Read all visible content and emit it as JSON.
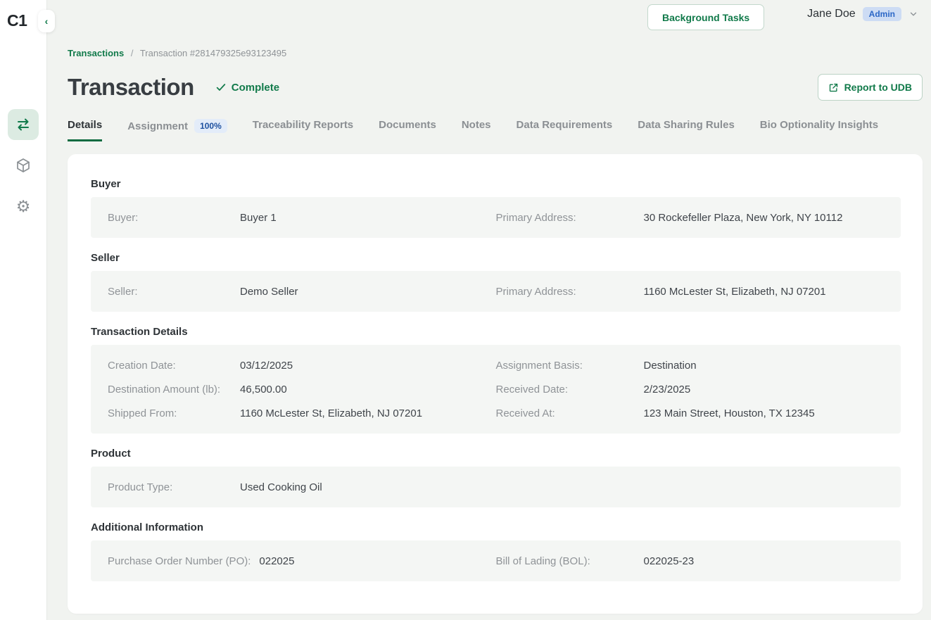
{
  "app": {
    "logo": "C1",
    "collapse_glyph": "‹"
  },
  "sidebar": {
    "items": [
      {
        "name": "transactions",
        "icon": "transfer-arrows-icon",
        "active": true
      },
      {
        "name": "products",
        "icon": "cube-icon",
        "active": false
      },
      {
        "name": "settings",
        "icon": "gear-icon",
        "active": false
      }
    ]
  },
  "topbar": {
    "background_tasks_label": "Background Tasks",
    "user_name": "Jane Doe",
    "user_role": "Admin"
  },
  "breadcrumb": {
    "root": "Transactions",
    "separator": "/",
    "current": "Transaction #281479325e93123495"
  },
  "page": {
    "title": "Transaction",
    "status_label": "Complete",
    "report_button_label": "Report to UDB"
  },
  "tabs": [
    {
      "label": "Details",
      "active": true
    },
    {
      "label": "Assignment",
      "badge": "100%"
    },
    {
      "label": "Traceability Reports"
    },
    {
      "label": "Documents"
    },
    {
      "label": "Notes"
    },
    {
      "label": "Data Requirements"
    },
    {
      "label": "Data Sharing Rules"
    },
    {
      "label": "Bio Optionality Insights"
    }
  ],
  "sections": [
    {
      "title": "Buyer",
      "rows": [
        [
          {
            "label": "Buyer:",
            "value": "Buyer 1"
          },
          {
            "label": "Primary Address:",
            "value": "30 Rockefeller Plaza, New York, NY 10112"
          }
        ]
      ]
    },
    {
      "title": "Seller",
      "rows": [
        [
          {
            "label": "Seller:",
            "value": "Demo Seller"
          },
          {
            "label": "Primary Address:",
            "value": "1160 McLester St, Elizabeth, NJ 07201"
          }
        ]
      ]
    },
    {
      "title": "Transaction Details",
      "rows": [
        [
          {
            "label": "Creation Date:",
            "value": "03/12/2025"
          },
          {
            "label": "Assignment Basis:",
            "value": "Destination"
          }
        ],
        [
          {
            "label": "Destination Amount (lb):",
            "value": "46,500.00"
          },
          {
            "label": "Received Date:",
            "value": "2/23/2025"
          }
        ],
        [
          {
            "label": "Shipped From:",
            "value": "1160 McLester St, Elizabeth, NJ 07201"
          },
          {
            "label": "Received At:",
            "value": "123 Main Street, Houston, TX 12345"
          }
        ]
      ]
    },
    {
      "title": "Product",
      "rows": [
        [
          {
            "label": "Product Type:",
            "value": "Used Cooking Oil"
          }
        ]
      ]
    },
    {
      "title": "Additional Information",
      "rows": [
        [
          {
            "label": "Purchase Order Number (PO):",
            "value": "022025"
          },
          {
            "label": "Bill of Lading (BOL):",
            "value": "022025-23"
          }
        ]
      ]
    }
  ],
  "colors": {
    "accent_green": "#117a4a",
    "tab_underline_green": "#0e6b41",
    "active_nav_bg": "#dcebe2",
    "page_bg": "#f1f3f0",
    "row_bg": "#f4f6f4",
    "badge_blue_bg": "#cddcf4",
    "badge_blue_text": "#2b67c6",
    "percent_badge_bg": "#e3ecf9",
    "percent_badge_text": "#1d509f"
  }
}
